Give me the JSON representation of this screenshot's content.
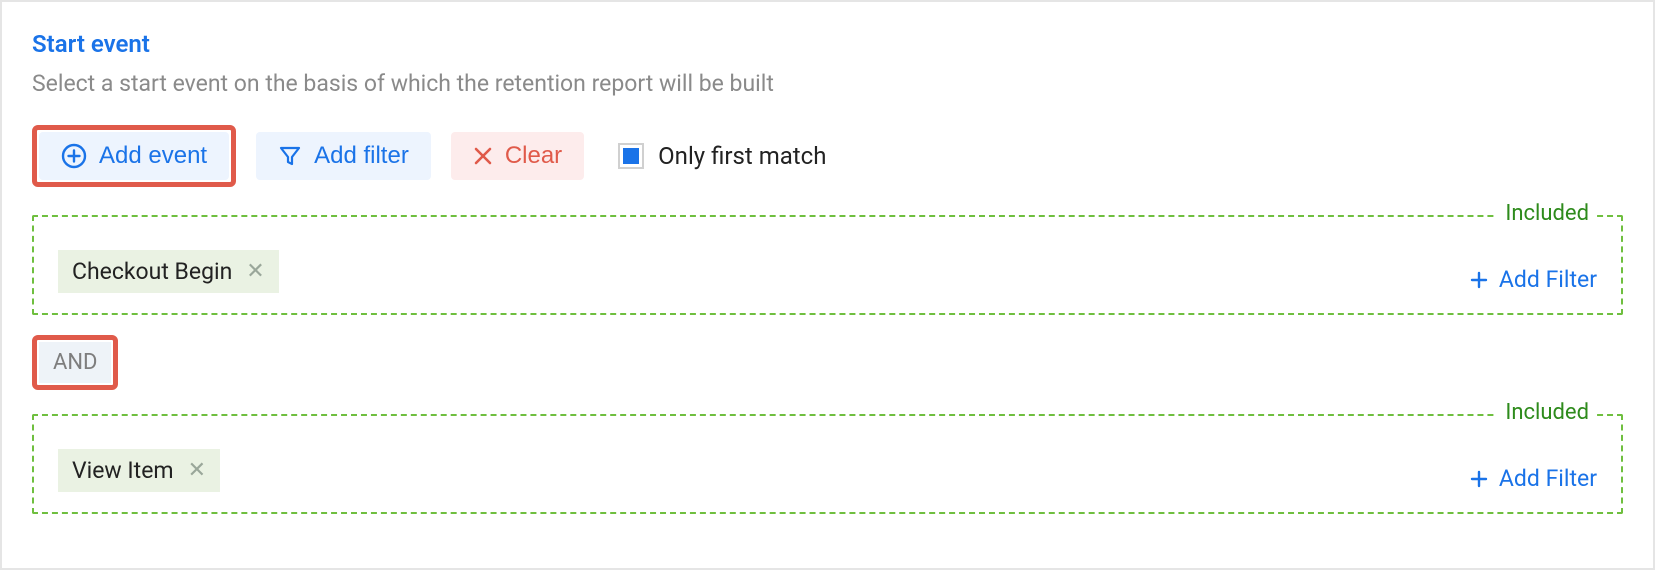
{
  "header": {
    "title": "Start event",
    "subtitle": "Select a start event on the basis of which the retention report will be built"
  },
  "toolbar": {
    "add_event": "Add event",
    "add_filter": "Add filter",
    "clear": "Clear",
    "only_first_match": "Only first match"
  },
  "events": [
    {
      "legend": "Included",
      "chip": "Checkout Begin",
      "add_filter": "Add Filter"
    },
    {
      "legend": "Included",
      "chip": "View Item",
      "add_filter": "Add Filter"
    }
  ],
  "logic_operator": "AND"
}
